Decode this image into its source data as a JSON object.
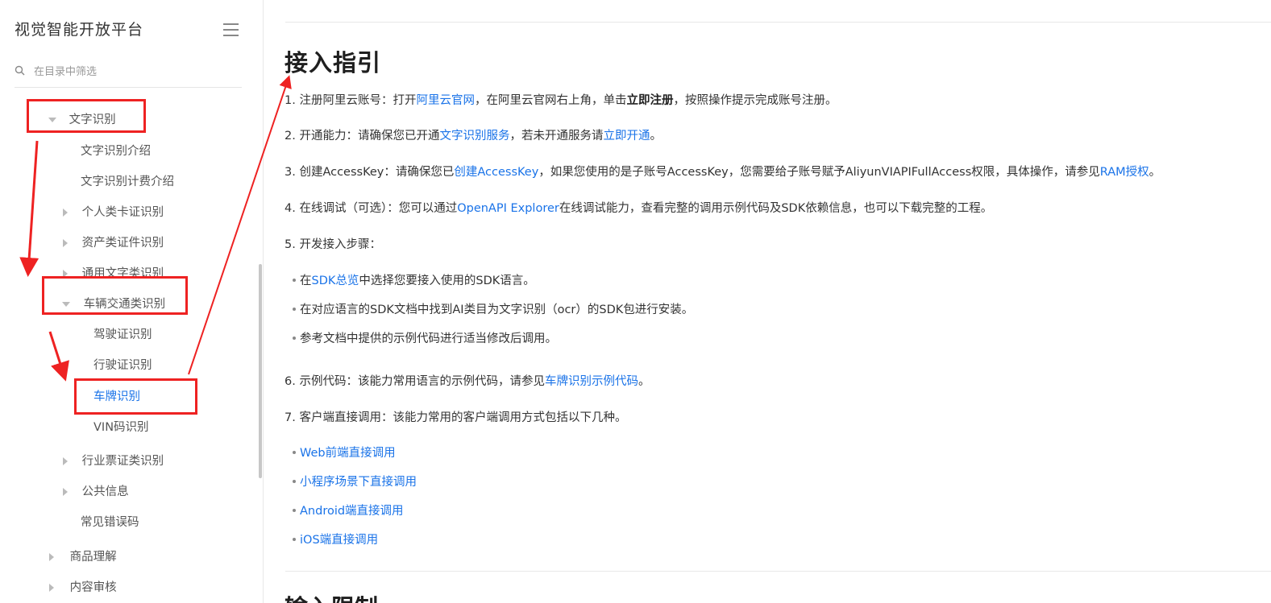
{
  "sidebar": {
    "brand": "视觉智能开放平台",
    "filter_placeholder": "在目录中筛选",
    "items": [
      {
        "label": "文字识别"
      },
      {
        "label": "文字识别介绍"
      },
      {
        "label": "文字识别计费介绍"
      },
      {
        "label": "个人类卡证识别"
      },
      {
        "label": "资产类证件识别"
      },
      {
        "label": "通用文字类识别"
      },
      {
        "label": "车辆交通类识别"
      },
      {
        "label": "驾驶证识别"
      },
      {
        "label": "行驶证识别"
      },
      {
        "label": "车牌识别"
      },
      {
        "label": "VIN码识别"
      },
      {
        "label": "行业票证类识别"
      },
      {
        "label": "公共信息"
      },
      {
        "label": "常见错误码"
      },
      {
        "label": "商品理解"
      },
      {
        "label": "内容审核"
      }
    ]
  },
  "main": {
    "title": "接入指引",
    "steps": {
      "s1": {
        "p1": "1. 注册阿里云账号：打开",
        "link1": "阿里云官网",
        "p2": "，在阿里云官网右上角，单击",
        "bold": "立即注册",
        "p3": "，按照操作提示完成账号注册。"
      },
      "s2": {
        "p1": "2. 开通能力：请确保您已开通",
        "link1": "文字识别服务",
        "p2": "，若未开通服务请",
        "link2": "立即开通",
        "p3": "。"
      },
      "s3": {
        "p1": "3. 创建AccessKey：请确保您已",
        "link1": "创建AccessKey",
        "p2": "，如果您使用的是子账号AccessKey，您需要给子账号赋予AliyunVIAPIFullAccess权限，具体操作，请参见",
        "link2": "RAM授权",
        "p3": "。"
      },
      "s4": {
        "p1": "4. 在线调试（可选）：您可以通过",
        "link1": "OpenAPI Explorer",
        "p2": "在线调试能力，查看完整的调用示例代码及SDK依赖信息，也可以下载完整的工程。"
      },
      "s5": {
        "p1": "5. 开发接入步骤："
      },
      "s6": {
        "p1": "6. 示例代码：该能力常用语言的示例代码，请参见",
        "link1": "车牌识别示例代码",
        "p2": "。"
      },
      "s7": {
        "p1": "7. 客户端直接调用：该能力常用的客户端调用方式包括以下几种。"
      }
    },
    "dev_steps": {
      "b1_p1": "在",
      "b1_link": "SDK总览",
      "b1_p2": "中选择您要接入使用的SDK语言。",
      "b2": "在对应语言的SDK文档中找到AI类目为文字识别（ocr）的SDK包进行安装。",
      "b3": "参考文档中提供的示例代码进行适当修改后调用。"
    },
    "client_links": [
      "Web前端直接调用",
      "小程序场景下直接调用",
      "Android端直接调用",
      "iOS端直接调用"
    ],
    "next_heading": "输入限制"
  },
  "colors": {
    "link": "#1a73e8",
    "annotation": "#ee2222",
    "text": "#333333"
  },
  "icons": [
    "hamburger-menu-icon",
    "search-icon",
    "caret-down-icon",
    "caret-right-icon"
  ]
}
